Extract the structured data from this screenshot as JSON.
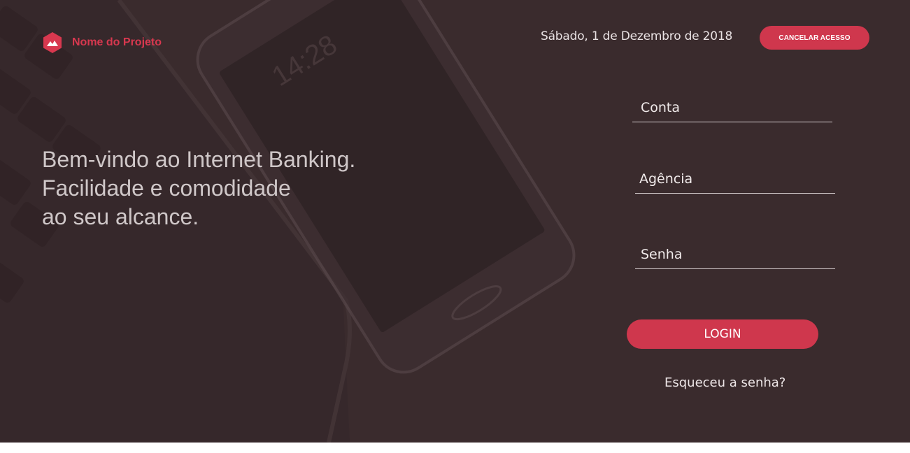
{
  "brand": {
    "name": "Nome do Projeto",
    "logo_icon": "mountain-hexagon-icon",
    "color": "#d8384f"
  },
  "header": {
    "date": "Sábado, 1 de Dezembro de 2018",
    "cancel_label": "CANCELAR ACESSO"
  },
  "hero": {
    "welcome_text": "Bem-vindo ao Internet Banking.\nFacilidade e comodidade\nao seu alcance.",
    "background_color": "#3a2b2d"
  },
  "login_form": {
    "account_placeholder": "Conta",
    "account_value": "",
    "agency_placeholder": "Agência",
    "agency_value": "",
    "password_placeholder": "Senha",
    "password_value": "",
    "login_label": "LOGIN",
    "forgot_label": "Esqueceu a senha?"
  },
  "phone_screen": {
    "clock": "14:28"
  }
}
